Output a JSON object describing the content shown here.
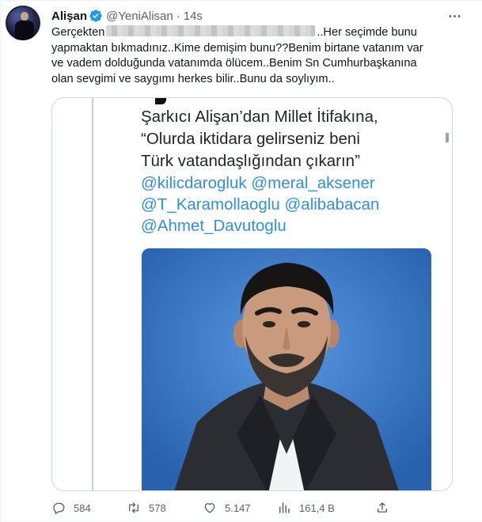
{
  "author": {
    "name": "Alişan",
    "handle": "@YeniAlisan",
    "separator": "·",
    "time": "14s"
  },
  "tweet": {
    "text_start": "Gerçekten",
    "text_rest": "..Her seçimde bunu yapmaktan bıkmadınız..Kime demişim bunu??Benim birtane vatanım var ve vadem dolduğunda vatanımda ölücem..Benim Sn Cumhurbaşkanına olan sevgimi ve saygımı herkes bilir..Bunu da soylıyım.."
  },
  "media": {
    "quote_lines": [
      "Şarkıcı Alişan’dan Millet İtifakına,",
      "“Olurda iktidara gelirseniz beni",
      "Türk vatandaşlığından çıkarın”"
    ],
    "mention_lines": [
      "@kilicdarogluk @meral_aksener",
      "@T_Karamollaoglu @alibabacan",
      "@Ahmet_Davutoglu"
    ]
  },
  "actions": {
    "replies": "584",
    "retweets": "578",
    "likes": "5.147",
    "views": "161,4 B"
  },
  "colors": {
    "verified": "#1d9bf0",
    "mention": "#2f8fe0",
    "secondary_text": "#536471"
  },
  "icons": [
    "verified-badge-icon",
    "more-icon",
    "reply-icon",
    "retweet-icon",
    "like-icon",
    "views-icon",
    "share-icon"
  ]
}
